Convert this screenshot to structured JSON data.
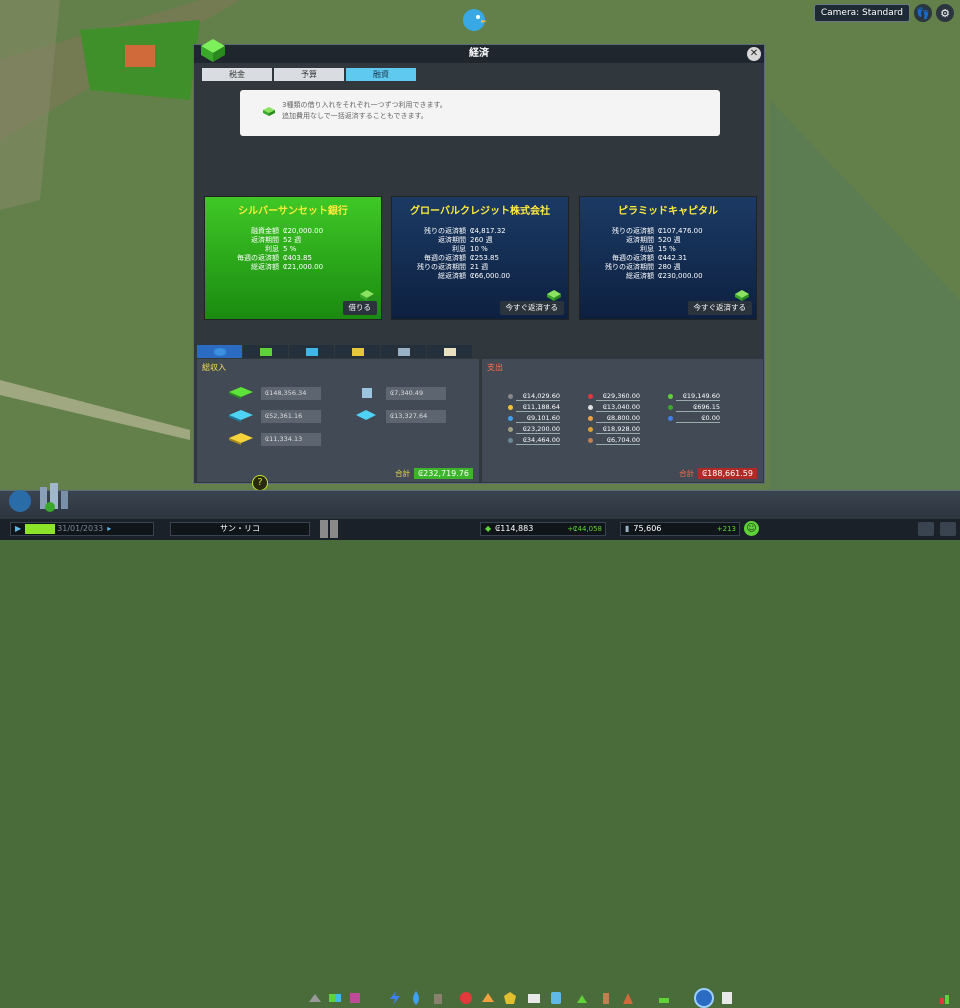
{
  "camera_label": "Camera: Standard",
  "window": {
    "title": "経済",
    "tabs": [
      {
        "label": "税金",
        "active": false
      },
      {
        "label": "予算",
        "active": false
      },
      {
        "label": "融資",
        "active": true
      }
    ],
    "info_line1": "3種類の借り入れをそれぞれ一つずつ利用できます。",
    "info_line2": "追加費用なしで一括返済することもできます。"
  },
  "banks": [
    {
      "name": "シルバーサンセット銀行",
      "style": "green",
      "rows": [
        {
          "k": "融資金額",
          "v": "₢20,000.00"
        },
        {
          "k": "返済期間",
          "v": "52 週"
        },
        {
          "k": "利息",
          "v": "5 %"
        },
        {
          "k": "毎週の返済額",
          "v": "₢403.85"
        },
        {
          "k": "総返済額",
          "v": "₢21,000.00"
        }
      ],
      "button": "借りる"
    },
    {
      "name": "グローバルクレジット株式会社",
      "style": "blue",
      "rows": [
        {
          "k": "残りの返済額",
          "v": "₢4,817.32"
        },
        {
          "k": "返済期間",
          "v": "260 週"
        },
        {
          "k": "利息",
          "v": "10 %"
        },
        {
          "k": "毎週の返済額",
          "v": "₢253.85"
        },
        {
          "k": "残りの返済期間",
          "v": "21 週"
        },
        {
          "k": "総返済額",
          "v": "₢66,000.00"
        }
      ],
      "button": "今すぐ返済する"
    },
    {
      "name": "ピラミッドキャピタル",
      "style": "blue",
      "rows": [
        {
          "k": "残りの返済額",
          "v": "₢107,476.00"
        },
        {
          "k": "返済期間",
          "v": "520 週"
        },
        {
          "k": "利息",
          "v": "15 %"
        },
        {
          "k": "毎週の返済額",
          "v": "₢442.31"
        },
        {
          "k": "残りの返済期間",
          "v": "280 週"
        },
        {
          "k": "総返済額",
          "v": "₢230,000.00"
        }
      ],
      "button": "今すぐ返済する"
    }
  ],
  "income": {
    "title": "総収入",
    "items": [
      "₢148,356.34",
      "₢52,361.16",
      "₢11,334.13",
      "₢7,340.49",
      "₢13,327.64"
    ],
    "total_label": "合計",
    "total": "₢232,719.76"
  },
  "expense": {
    "title": "支出",
    "col1": [
      "₢14,029.60",
      "₢11,188.64",
      "₢9,101.60",
      "₢23,200.00",
      "₢34,464.00"
    ],
    "col2": [
      "₢29,360.00",
      "₢13,040.00",
      "₢8,800.00",
      "₢18,928.00",
      "₢6,704.00"
    ],
    "col3": [
      "₢19,149.60",
      "₢696.15",
      "₢0.00"
    ],
    "total_label": "合計",
    "total": "₢188,661.59"
  },
  "status": {
    "date": "31/01/2033",
    "city": "サン・リコ",
    "money": "₢114,883",
    "money_delta": "+₢44,058",
    "population": "75,606",
    "pop_delta": "+213"
  },
  "colors": {
    "accent_green": "#3cb52a",
    "accent_blue": "#5fc9ef",
    "expense_red": "#b22a25",
    "yellow": "#ffeb3b"
  }
}
